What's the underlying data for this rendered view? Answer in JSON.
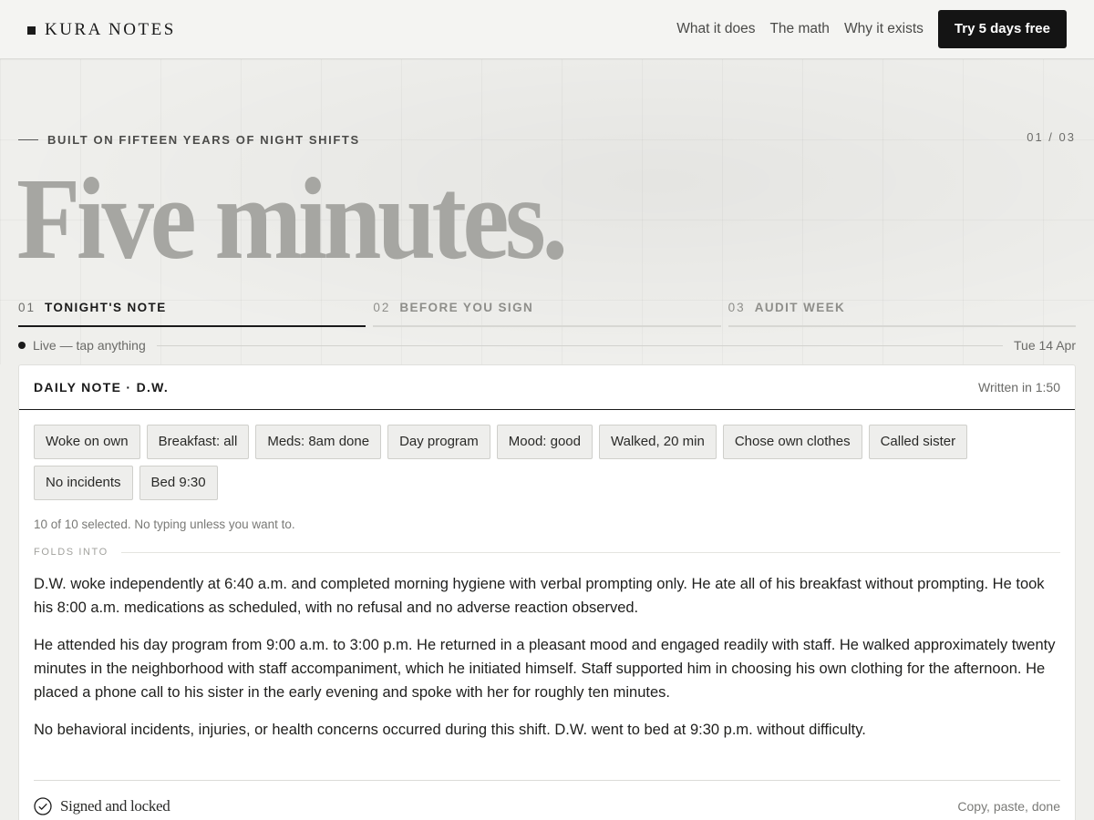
{
  "header": {
    "brand": "KURA NOTES",
    "nav": [
      "What it does",
      "The math",
      "Why it exists"
    ],
    "cta": "Try 5 days free"
  },
  "hero": {
    "eyebrow": "BUILT ON FIFTEEN YEARS OF NIGHT SHIFTS",
    "pager": "01 / 03",
    "title": "Five minutes."
  },
  "tabs": [
    {
      "num": "01",
      "label": "TONIGHT'S NOTE",
      "active": true
    },
    {
      "num": "02",
      "label": "BEFORE YOU SIGN",
      "active": false
    },
    {
      "num": "03",
      "label": "AUDIT WEEK",
      "active": false
    }
  ],
  "status": {
    "live": "Live — tap anything",
    "date": "Tue 14 Apr"
  },
  "note": {
    "title": "DAILY NOTE · D.W.",
    "timer": "Written in 1:50",
    "chips": [
      "Woke on own",
      "Breakfast: all",
      "Meds: 8am done",
      "Day program",
      "Mood: good",
      "Walked, 20 min",
      "Chose own clothes",
      "Called sister",
      "No incidents",
      "Bed 9:30"
    ],
    "selected_count": "10 of 10 selected. No typing unless you want to.",
    "folds_label": "FOLDS INTO",
    "paragraphs": [
      "D.W. woke independently at 6:40 a.m. and completed morning hygiene with verbal prompting only. He ate all of his breakfast without prompting. He took his 8:00 a.m. medications as scheduled, with no refusal and no adverse reaction observed.",
      "He attended his day program from 9:00 a.m. to 3:00 p.m. He returned in a pleasant mood and engaged readily with staff. He walked approximately twenty minutes in the neighborhood with staff accompaniment, which he initiated himself. Staff supported him in choosing his own clothing for the afternoon. He placed a phone call to his sister in the early evening and spoke with her for roughly ten minutes.",
      "No behavioral incidents, injuries, or health concerns occurred during this shift. D.W. went to bed at 9:30 p.m. without difficulty."
    ],
    "signed": "Signed and locked",
    "copy": "Copy, paste, done"
  }
}
